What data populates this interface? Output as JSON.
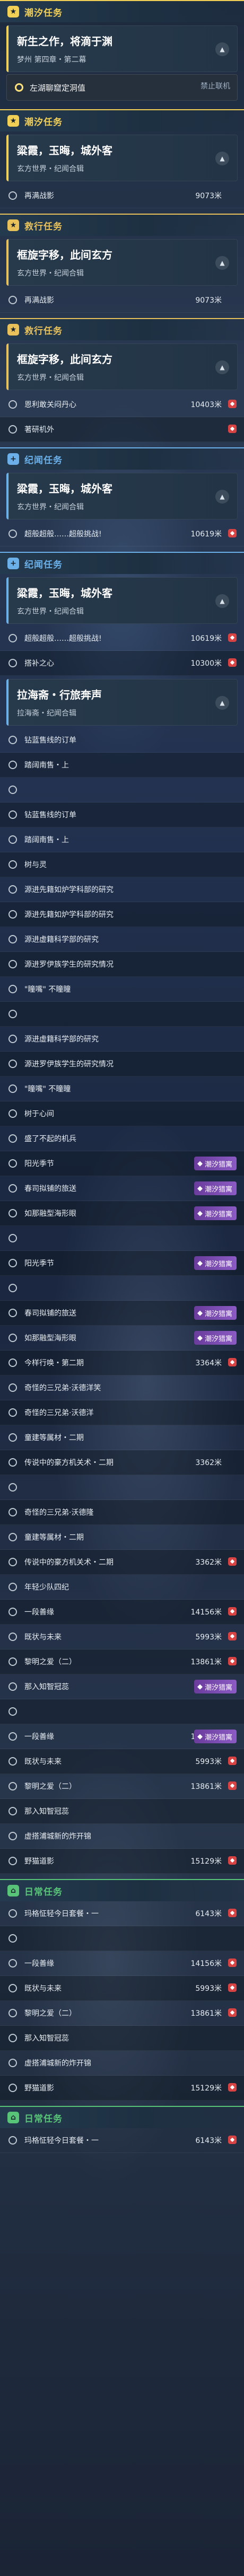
{
  "colors": {
    "main": "#f2cf55",
    "side": "#e9c15a",
    "daily": "#58c478",
    "legend": "#6bb0e8",
    "purple_tag": "#7c4db6"
  },
  "sections": [
    {
      "title": "潮汐任务",
      "accent": "main",
      "icon": "★",
      "card": {
        "name": "新生之作，将滴于渊",
        "loc": "梦州 第四章・第二幕"
      },
      "nav": {
        "label": "左湖聊窟定洞值",
        "tag": "禁止联机"
      },
      "rows": []
    },
    {
      "title": "潮汐任务",
      "accent": "main",
      "icon": "★",
      "card": {
        "name": "粱霞，玉晦，城外客",
        "loc": "玄方世界・纪闻合辑"
      },
      "rows": [
        {
          "label": "再满战影",
          "dist": "9073米",
          "pin": false
        }
      ]
    },
    {
      "title": "救行任务",
      "accent": "side",
      "icon": "★",
      "card": {
        "name": "框旋字移，此间玄方",
        "loc": "玄方世界・纪闻合辑"
      },
      "rows": [
        {
          "label": "再满战影",
          "dist": "9073米",
          "pin": false
        }
      ]
    },
    {
      "title": "救行任务",
      "accent": "side",
      "icon": "★",
      "card": {
        "name": "框旋字移，此间玄方",
        "loc": "玄方世界・纪闻合辑"
      },
      "rows": [
        {
          "label": "恩利敢关闷丹心",
          "dist": "10403米",
          "pin": true
        },
        {
          "label": "著研机外",
          "dist": "",
          "pin": true
        }
      ]
    },
    {
      "title": "纪闻任务",
      "accent": "legend",
      "icon": "+",
      "card": {
        "name": "粱霞，玉晦，城外客",
        "loc": "玄方世界・纪闻合辑"
      },
      "rows": [
        {
          "label": "超般超般……超般挑战!",
          "dist": "10619米",
          "pin": true
        }
      ]
    },
    {
      "title": "纪闻任务",
      "accent": "legend",
      "icon": "+",
      "card": {
        "name": "粱霞，玉晦，城外客",
        "loc": "玄方世界・纪闻合辑"
      },
      "rows": [
        {
          "label": "超般超般……超般挑战!",
          "dist": "10619米",
          "pin": true
        },
        {
          "label": "搭补之心",
          "dist": "10300米",
          "pin": true
        }
      ],
      "card2": {
        "name": "拉海斋・行旅奔声",
        "loc": "拉海斋・纪闻合辑"
      },
      "rows2": [
        {
          "label": "钻蓝售线的订单",
          "dist": "",
          "pin": false
        },
        {
          "label": "踏阔南售・上",
          "dist": "",
          "pin": false
        },
        {
          "label": "",
          "dist": "",
          "pin": false
        },
        {
          "label": "钻蓝售线的订单",
          "dist": "",
          "pin": false
        },
        {
          "label": "踏阔南售・上",
          "dist": "",
          "pin": false
        },
        {
          "label": "树与灵",
          "dist": "",
          "pin": false
        },
        {
          "label": "源进先籍如炉学科部的研究",
          "dist": "",
          "pin": false
        },
        {
          "label": "源进先籍如炉学科部的研究",
          "dist": "",
          "pin": false
        },
        {
          "label": "源进虚籍科学部的研究",
          "dist": "",
          "pin": false
        },
        {
          "label": "源进罗伊族学生的研究情况",
          "dist": "",
          "pin": false
        },
        {
          "label": "\"瞳嘴\" 不瞳瞳",
          "dist": "",
          "pin": false
        },
        {
          "label": "",
          "dist": "",
          "pin": false
        },
        {
          "label": "源进虚籍科学部的研究",
          "dist": "",
          "pin": false
        },
        {
          "label": "源进罗伊族学生的研究情况",
          "dist": "",
          "pin": false
        },
        {
          "label": "\"瞳嘴\" 不瞳瞳",
          "dist": "",
          "pin": false
        },
        {
          "label": "树于心间",
          "dist": "",
          "pin": false
        },
        {
          "label": "盛了不起的机兵",
          "dist": "",
          "pin": false
        },
        {
          "label": "阳光季节",
          "dist": "",
          "tag": "潮汐猎寓",
          "pin": false
        },
        {
          "label": "春司拟铺的旅送",
          "dist": "",
          "tag": "潮汐猎寓",
          "pin": false
        },
        {
          "label": "如那融型海形眼",
          "dist": "",
          "tag": "潮汐猎寓",
          "pin": false
        },
        {
          "label": "",
          "dist": "",
          "pin": false
        },
        {
          "label": "阳光季节",
          "dist": "",
          "tag": "潮汐猎寓",
          "pin": false
        },
        {
          "label": "",
          "dist": "",
          "pin": false
        },
        {
          "label": "春司拟铺的旅送",
          "dist": "",
          "tag": "潮汐猎寓",
          "pin": false
        },
        {
          "label": "如那融型海形眼",
          "dist": "",
          "tag": "潮汐猎寓",
          "pin": false
        },
        {
          "label": "今样行唤・第二期",
          "dist": "3364米",
          "pin": true
        },
        {
          "label": "奇怪的三兄弟·沃德洋笑",
          "dist": "",
          "pin": false
        },
        {
          "label": "奇怪的三兄弟·沃德洋",
          "dist": "",
          "pin": false
        },
        {
          "label": "童建等属材・二期",
          "dist": "",
          "pin": false
        },
        {
          "label": "传说中的豪方机关术・二期",
          "dist": "3362米",
          "pin": false
        },
        {
          "label": "",
          "dist": "",
          "pin": false
        },
        {
          "label": "奇怪的三兄弟·沃德隆",
          "dist": "",
          "pin": false
        },
        {
          "label": "童建等属材・二期",
          "dist": "",
          "pin": false
        },
        {
          "label": "传说中的豪方机关术・二期",
          "dist": "3362米",
          "pin": true
        },
        {
          "label": "年轻少队四纪",
          "dist": "",
          "pin": false
        },
        {
          "label": "一段善缘",
          "dist": "14156米",
          "pin": true
        },
        {
          "label": "既状与未来",
          "dist": "5993米",
          "pin": true
        },
        {
          "label": "黎明之爱（二）",
          "dist": "13861米",
          "pin": true
        },
        {
          "label": "那入知智冠蕊",
          "dist": "",
          "tag": "潮汐猎寓",
          "pin": false
        },
        {
          "label": "",
          "dist": "",
          "pin": false
        },
        {
          "label": "一段善缘",
          "dist": "14156米",
          "tag": "潮汐猎寓",
          "pin": false
        },
        {
          "label": "既状与未来",
          "dist": "5993米",
          "pin": true
        },
        {
          "label": "黎明之爱（二）",
          "dist": "13861米",
          "pin": true
        },
        {
          "label": "那入知智冠蕊",
          "dist": "",
          "pin": false
        },
        {
          "label": "虚搭浦城新的炸开锦",
          "dist": "",
          "pin": false
        },
        {
          "label": "野猫道影",
          "dist": "15129米",
          "pin": true
        }
      ]
    },
    {
      "title": "日常任务",
      "accent": "daily",
      "icon": "⌂",
      "rows": [
        {
          "label": "玛格怔轻今日套餐・一",
          "dist": "6143米",
          "pin": true
        },
        {
          "label": "",
          "dist": "",
          "pin": false
        },
        {
          "label": "一段善缘",
          "dist": "14156米",
          "pin": true
        },
        {
          "label": "既状与未来",
          "dist": "5993米",
          "pin": true
        },
        {
          "label": "黎明之爱（二）",
          "dist": "13861米",
          "pin": true
        },
        {
          "label": "那入知智冠蕊",
          "dist": "",
          "pin": false
        },
        {
          "label": "虚搭浦城新的炸开锦",
          "dist": "",
          "pin": false
        },
        {
          "label": "野猫道影",
          "dist": "15129米",
          "pin": true
        }
      ]
    },
    {
      "title": "日常任务",
      "accent": "daily",
      "icon": "⌂",
      "rows": [
        {
          "label": "玛格怔轻今日套餐・一",
          "dist": "6143米",
          "pin": true
        }
      ]
    }
  ]
}
